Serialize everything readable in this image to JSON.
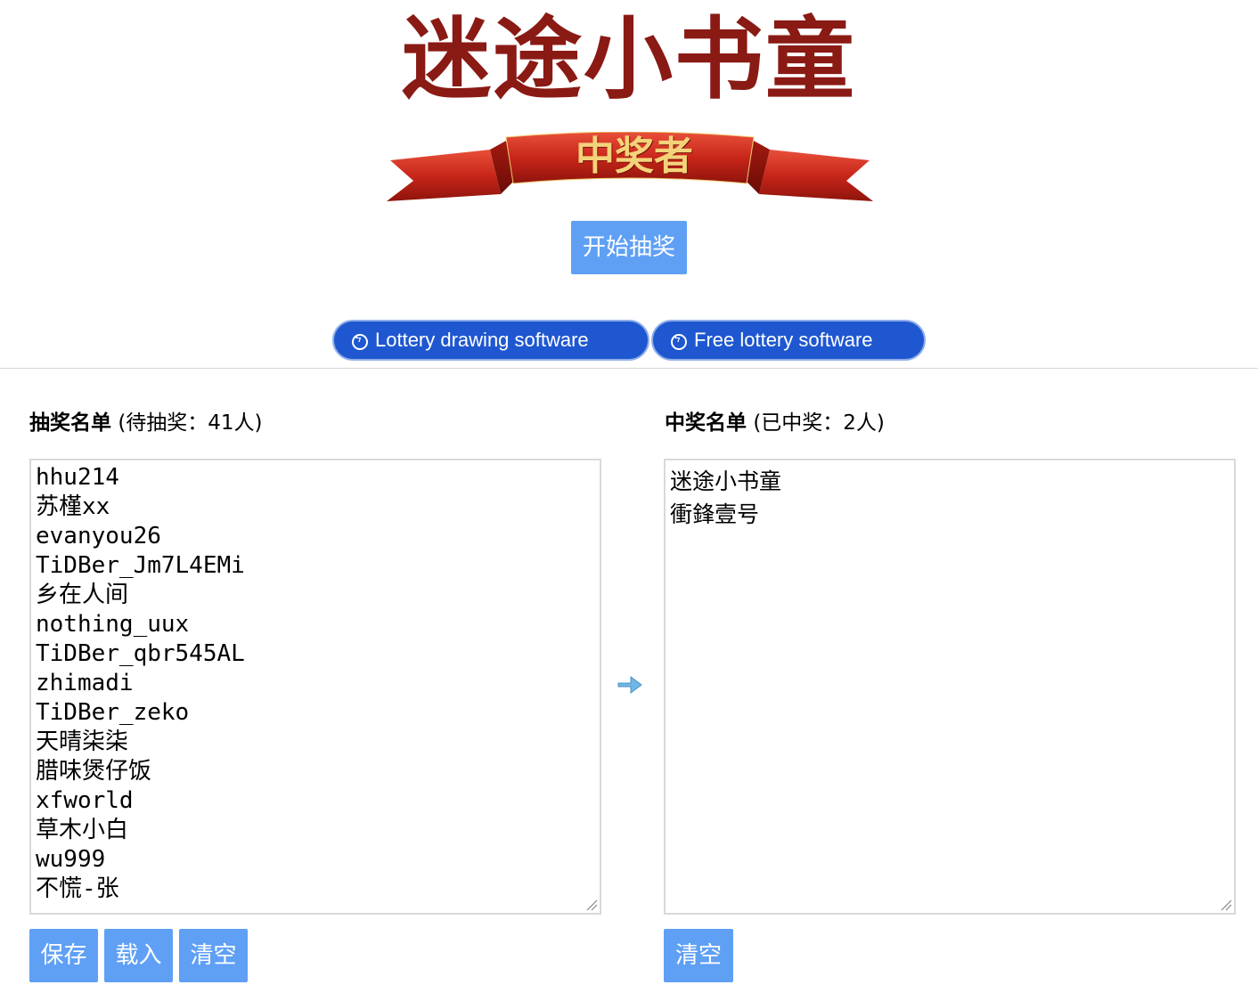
{
  "header": {
    "title": "迷途小书童",
    "ribbon_text": "中奖者",
    "start_button": "开始抽奖"
  },
  "links": [
    {
      "label": "Lottery drawing software"
    },
    {
      "label": "Free lottery software"
    }
  ],
  "left_panel": {
    "title": "抽奖名单",
    "count_text": "(待抽奖：41人)",
    "items": [
      "hhu214",
      "苏槿xx",
      "evanyou26",
      "TiDBer_Jm7L4EMi",
      "乡在人间",
      "nothing_uux",
      "TiDBer_qbr545AL",
      "zhimadi",
      "TiDBer_zeko",
      "天晴柒柒",
      "腊味煲仔饭",
      "xfworld",
      "草木小白",
      "wu999",
      "不慌-张"
    ],
    "buttons": {
      "save": "保存",
      "load": "载入",
      "clear": "清空"
    }
  },
  "right_panel": {
    "title": "中奖名单",
    "count_text": "(已中奖：2人)",
    "items": [
      "迷途小书童",
      "衝鋒壹号"
    ],
    "buttons": {
      "clear": "清空"
    }
  },
  "colors": {
    "title": "#8a1a14",
    "button": "#5fa0f5",
    "pill": "#1f57d0"
  }
}
